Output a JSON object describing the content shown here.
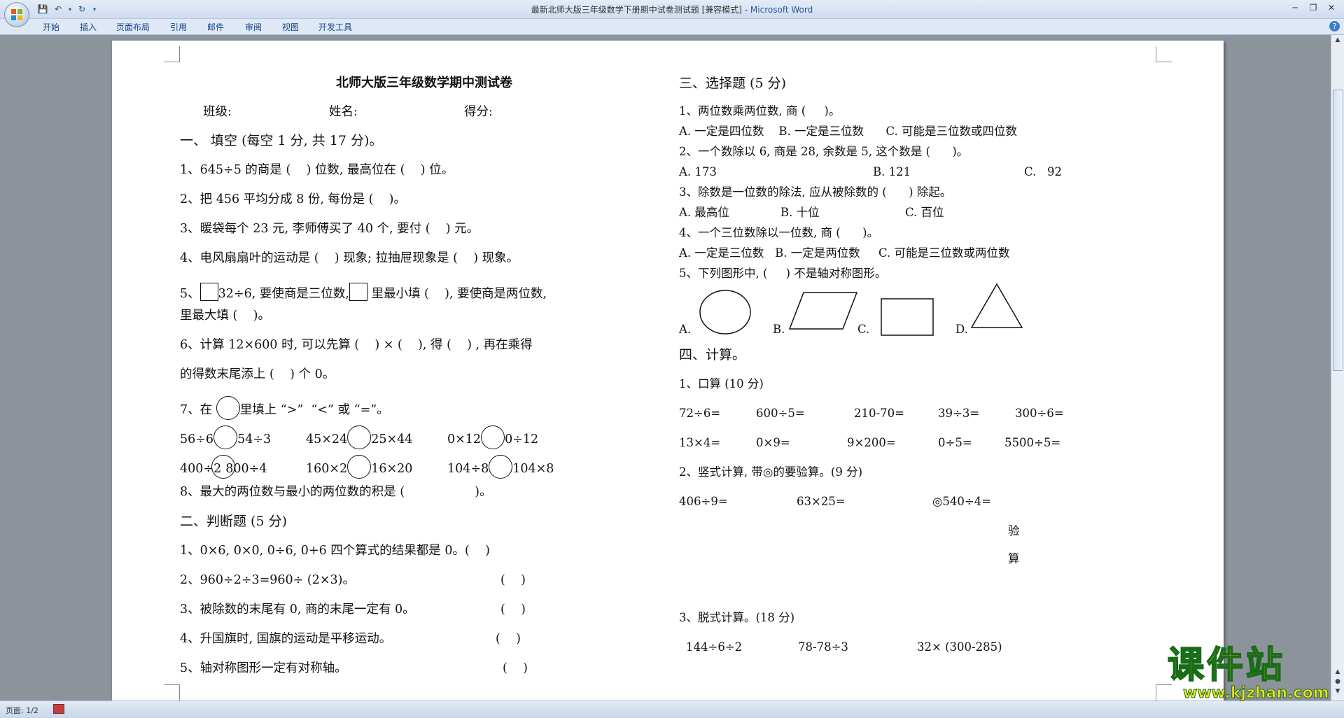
{
  "window": {
    "title_doc": "最新北师大版三年级数学下册期中试卷测试题 [兼容模式] - ",
    "title_app": "Microsoft Word",
    "quick_access": [
      "save-icon",
      "undo-icon",
      "redo-icon",
      "customize-icon"
    ]
  },
  "ribbon": {
    "tabs": [
      "开始",
      "插入",
      "页面布局",
      "引用",
      "邮件",
      "审阅",
      "视图",
      "开发工具"
    ],
    "help": "?"
  },
  "status": {
    "page": "页面: 1/2"
  },
  "doc": {
    "title": "北师大版三年级数学期中测试卷",
    "header": {
      "class": "班级:",
      "name": "姓名:",
      "score": "得分:"
    },
    "sec1": "一、 填空 (每空 1 分, 共 17 分)。",
    "q1": "1、645÷5 的商是 (    ) 位数, 最高位在 (    ) 位。",
    "q2": "2、把 456 平均分成 8 份, 每份是 (    )。",
    "q3": "3、暖袋每个 23 元, 李师傅买了 40 个, 要付 (    ) 元。",
    "q4": "4、电风扇扇叶的运动是 (    ) 现象; 拉抽屉现象是 (    ) 现象。",
    "q5a": "5、",
    "q5b": "32÷6, 要使商是三位数,",
    "q5c": " 里最小填 (    ), 要使商是两位数,",
    "q5d": "里最大填 (    )。",
    "q6a": "6、计算 12×600 时, 可以先算 (    ) × (    ), 得 (    ) , 再在乘得",
    "q6b": "的得数末尾添上 (    ) 个 0。",
    "q7a": "7、在 ",
    "q7b": "里填上 “>”  “<” 或 “=”。",
    "cmp": [
      [
        "56÷6",
        "54÷3"
      ],
      [
        "45×24",
        "25×44"
      ],
      [
        "0×12",
        "0÷12"
      ],
      [
        "400÷2",
        "800÷4"
      ],
      [
        "160×2",
        "16×20"
      ],
      [
        "104÷8",
        "104×8"
      ]
    ],
    "q8": "8、最大的两位数与最小的两位数的积是 (                  )。",
    "sec2": "二、判断题 (5 分)",
    "j1": "1、0×6, 0×0, 0÷6, 0+6 四个算式的结果都是 0。(    )",
    "j2": "2、960÷2÷3=960÷ (2×3)。",
    "j3": "3、被除数的末尾有 0, 商的末尾一定有 0。",
    "j4": "4、升国旗时, 国旗的运动是平移运动。",
    "j5": "5、轴对称图形一定有对称轴。",
    "paren": "(    )",
    "sec3": "三、选择题 (5 分)",
    "c1": "1、两位数乘两位数, 商 (     )。",
    "c1o": "A. 一定是四位数    B. 一定是三位数      C. 可能是三位数或四位数",
    "c2": "2、一个数除以 6, 商是 28, 余数是 5, 这个数是 (      )。",
    "c2o": [
      "A. 173",
      "B. 121",
      "C.   92"
    ],
    "c3": "3、除数是一位数的除法, 应从被除数的 (      ) 除起。",
    "c3o": [
      "A. 最高位",
      "B. 十位",
      "C. 百位"
    ],
    "c4": "4、一个三位数除以一位数, 商 (      )。",
    "c4o": "A. 一定是三位数   B. 一定是两位数     C. 可能是三位数或两位数",
    "c5": "5、下列图形中, (     ) 不是轴对称图形。",
    "c5o": [
      "A.",
      "B.",
      "C.",
      "D."
    ],
    "sec4": "四、计算。",
    "k1": "1、口算 (10 分)",
    "oral1": [
      "72÷6=",
      "600÷5=",
      "210-70=",
      "39÷3=",
      "300÷6="
    ],
    "oral2": [
      "13×4=",
      "0×9=",
      "9×200=",
      "0÷5=",
      "5500÷5="
    ],
    "k2": "2、竖式计算, 带◎的要验算。(9 分)",
    "vert": [
      "406÷9=",
      "63×25=",
      "◎540÷4="
    ],
    "check1": "验",
    "check2": "算",
    "k3": "3、脱式计算。(18 分)",
    "step": [
      "144÷6÷2",
      "78-78÷3",
      "32× (300-285)"
    ]
  },
  "watermark": {
    "text": "课件站",
    "url": "www.kjzhan.com"
  }
}
